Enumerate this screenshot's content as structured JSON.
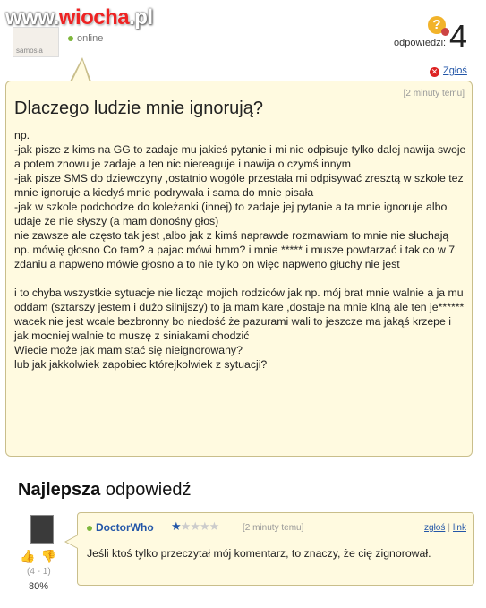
{
  "watermark": {
    "part1": "www.",
    "part2": "wiocha",
    "part3": ".pl"
  },
  "user": {
    "avatar_text": "samosia",
    "status": "online"
  },
  "answers": {
    "label": "odpowiedzi:",
    "count": "4"
  },
  "report_label": "Zgłoś",
  "question": {
    "time": "[2 minuty temu]",
    "title": "Dlaczego ludzie mnie ignorują?",
    "body": "np.\n-jak pisze z kims na GG to zadaje mu jakieś pytanie i mi nie odpisuje tylko dalej nawija swoje a potem znowu je zadaje a ten nic niereaguje i nawija o czymś innym\n-jak pisze SMS do dziewczyny ,ostatnio wogóle przestała mi odpisywać zresztą w szkole tez mnie ignoruje a kiedyś mnie podrywała i sama do mnie pisała\n-jak w szkole podchodze do koleżanki (innej) to zadaje jej pytanie a ta mnie ignoruje albo udaje że nie słyszy (a mam donośny głos)\nnie zawsze ale często tak jest ,albo jak z kimś naprawde rozmawiam to mnie nie słuchają np. mówię głosno Co tam? a pajac mówi hmm? i mnie ***** i musze powtarzać i tak co w 7 zdaniu a napweno mówie głosno a to nie tylko on więc napweno głuchy nie jest\n\ni to chyba wszystkie sytuacje nie licząc mojich rodziców jak np. mój brat mnie walnie a ja mu oddam (sztarszy jestem i dużo silnijszy) to ja mam kare ,dostaje na mnie klną ale ten je****** wacek nie jest wcale bezbronny bo niedość że pazurami wali to jeszcze ma jakąś krzepe i jak mocniej walnie to muszę z siniakami chodzić\nWiecie może jak mam stać się nieignorowany?\nlub jak jakkolwiek zapobiec którejkolwiek z sytuacji?"
  },
  "best": {
    "bold": "Najlepsza",
    "rest": " odpowiedź"
  },
  "answer": {
    "author": "DoctorWho",
    "rating": 1,
    "stars_max": 5,
    "time": "[2 minuty temu]",
    "report": "zgłoś",
    "link": "link",
    "text": "Jeśli ktoś tylko przeczytał mój komentarz, to znaczy, że cię zignorował.",
    "votes": "(4 - 1)",
    "percent": "80%"
  },
  "colors": {
    "bubble": "#fffae0",
    "bubble_border": "#c9be8b",
    "link": "#2356a8",
    "online": "#7db63b"
  }
}
